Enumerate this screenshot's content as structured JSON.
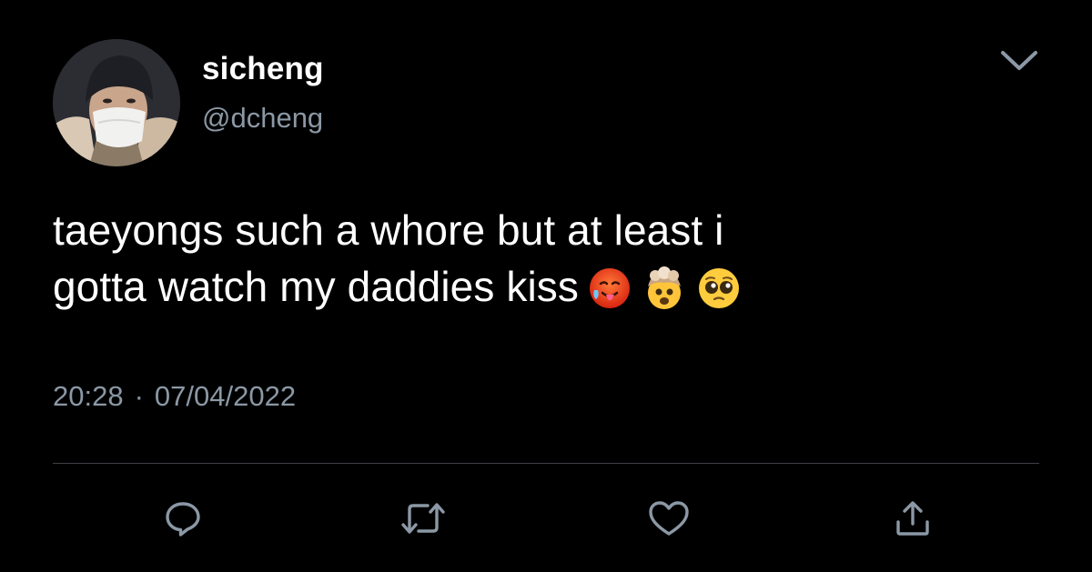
{
  "user": {
    "display_name": "sicheng",
    "handle": "@dcheng",
    "avatar_icon": "profile-photo"
  },
  "tweet": {
    "text_line_1": "taeyongs such a whore but at least i",
    "text_line_2": "gotta watch my daddies kiss",
    "emojis": [
      "hot-face-emoji",
      "exploding-head-emoji",
      "pleading-face-emoji"
    ],
    "time": "20:28",
    "separator": "·",
    "date": "07/04/2022"
  },
  "actions": [
    "reply-icon",
    "retweet-icon",
    "like-icon",
    "share-icon"
  ],
  "colors": {
    "background": "#000000",
    "text_primary": "#ffffff",
    "text_secondary": "#8b98a5",
    "divider": "#3d4147",
    "icon": "#8b98a5"
  }
}
